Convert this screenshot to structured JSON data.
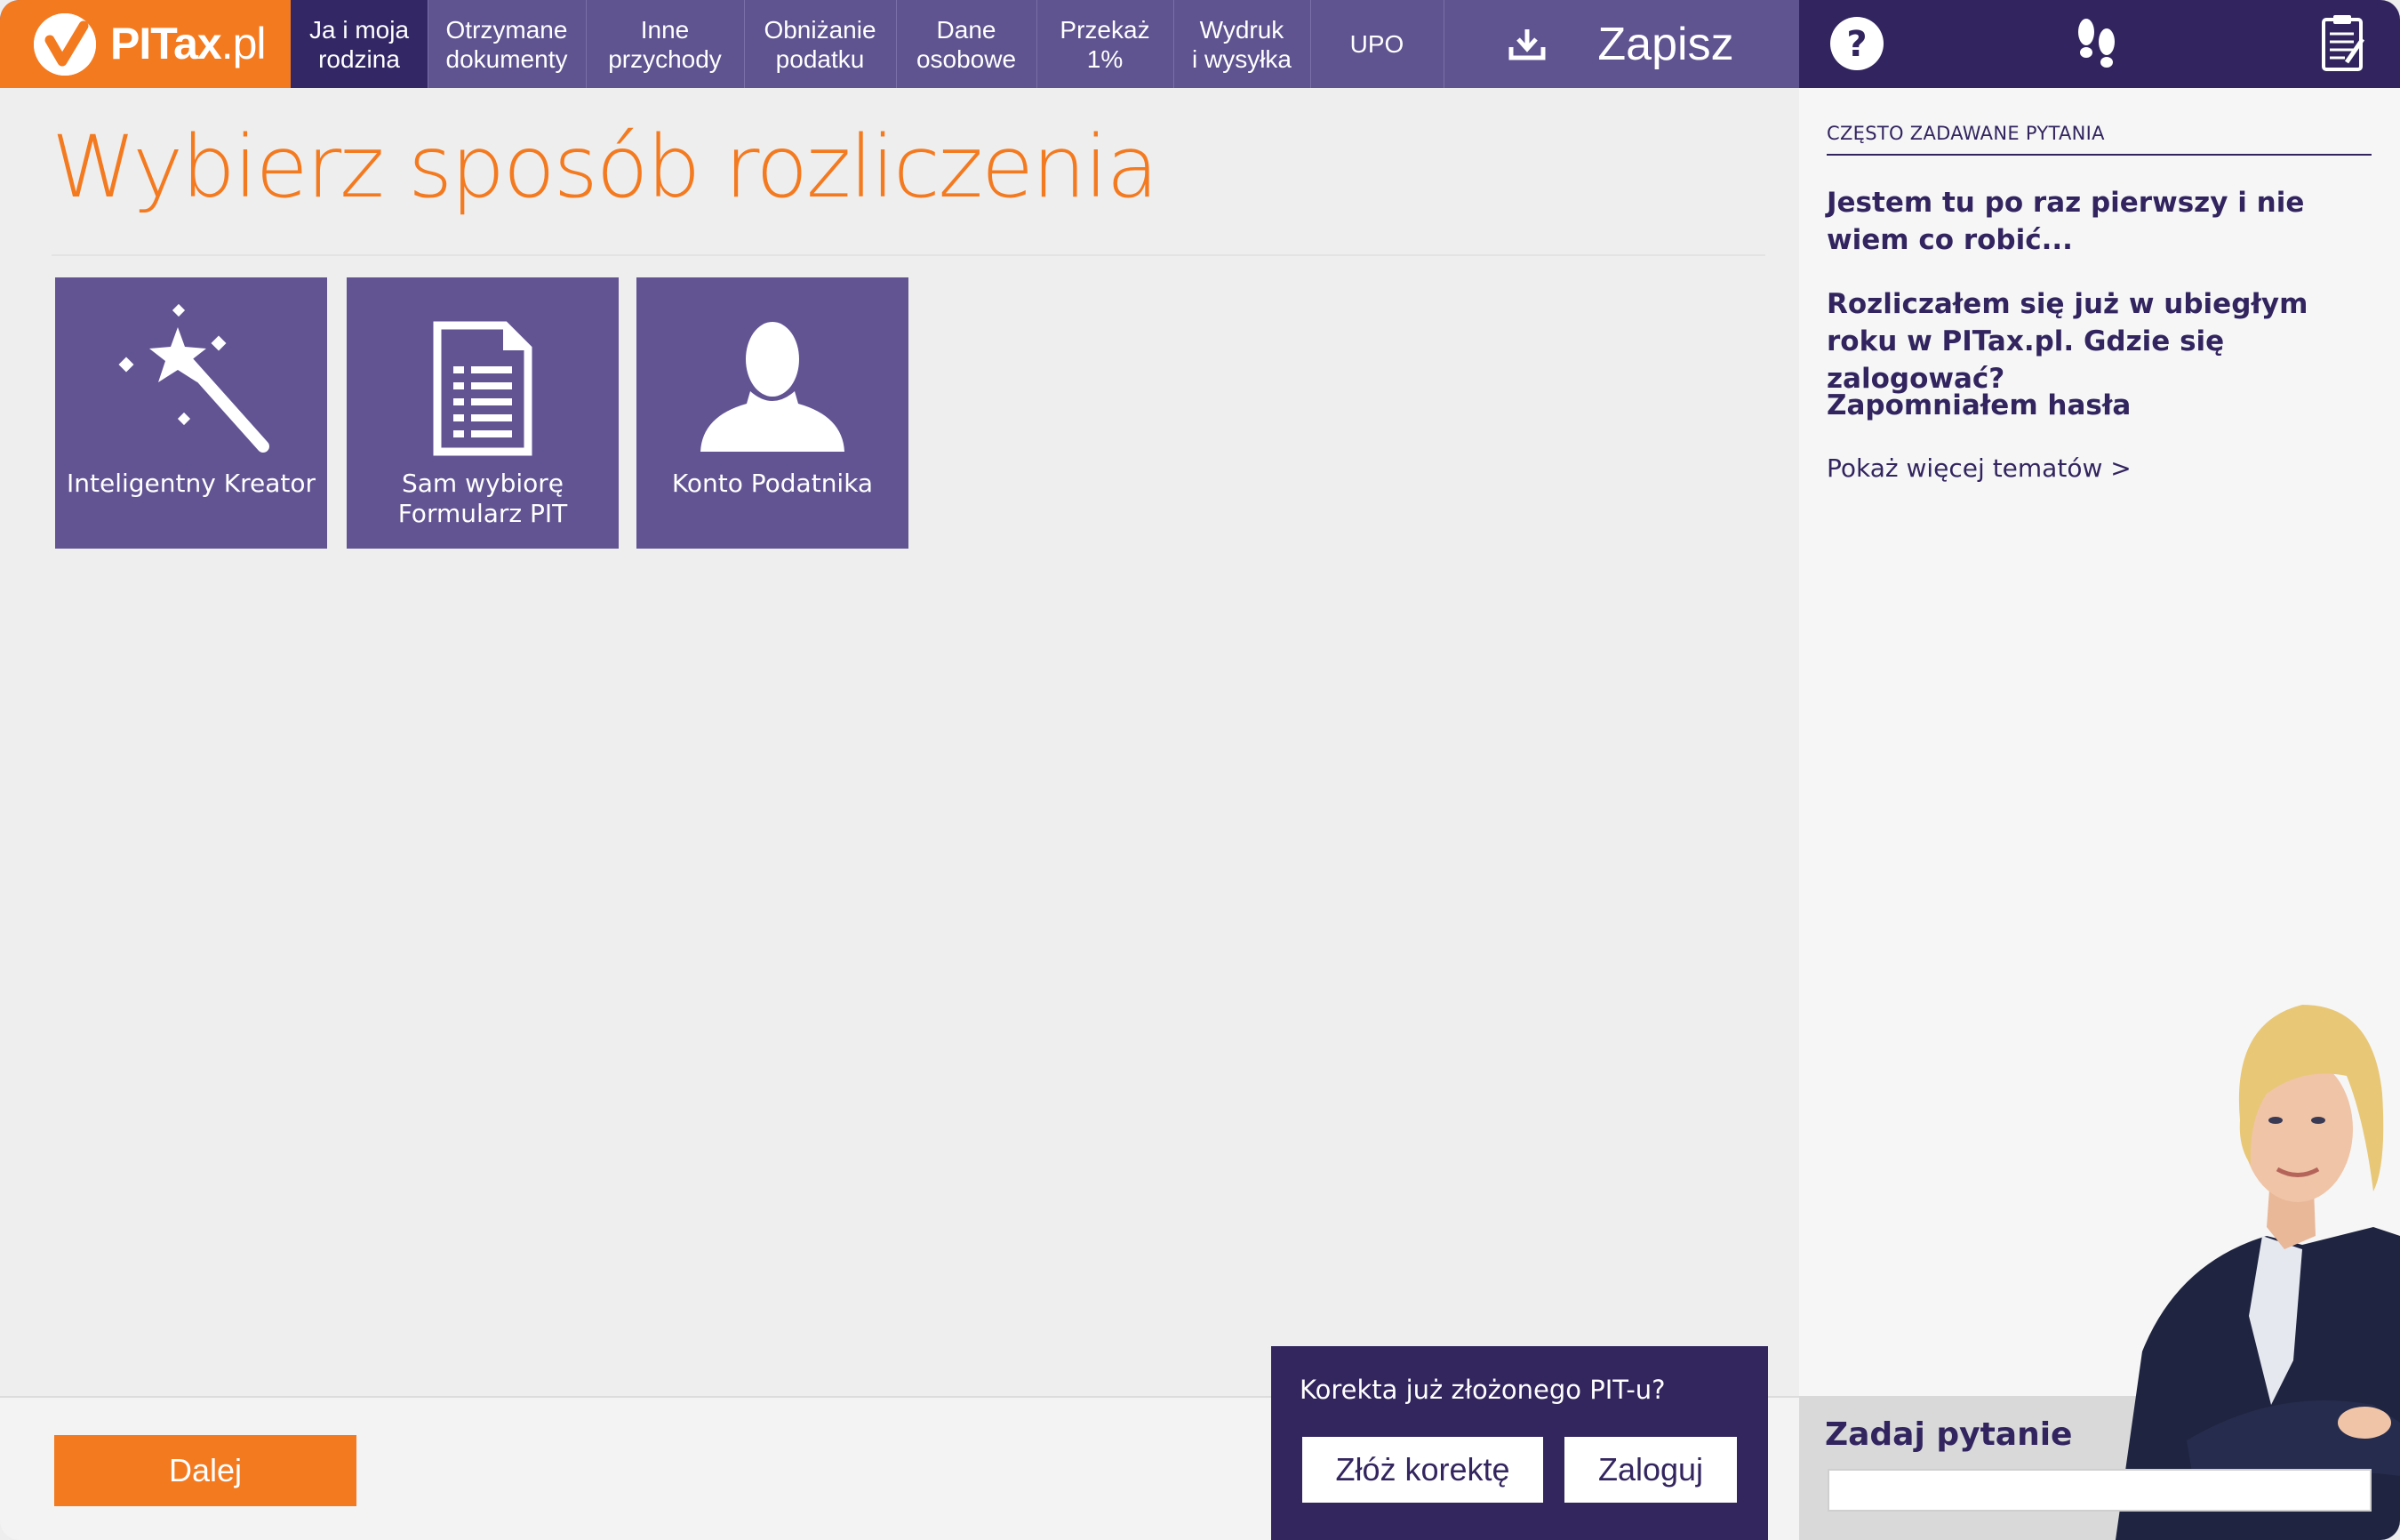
{
  "logo": {
    "text_bold": "PITax",
    "text_light": ".pl"
  },
  "nav": {
    "tabs": [
      {
        "label": "Ja i moja\nrodzina",
        "active": true
      },
      {
        "label": "Otrzymane\ndokumenty",
        "active": false
      },
      {
        "label": "Inne\nprzychody",
        "active": false
      },
      {
        "label": "Obniżanie\npodatku",
        "active": false
      },
      {
        "label": "Dane\nosobowe",
        "active": false
      },
      {
        "label": "Przekaż\n1%",
        "active": false
      },
      {
        "label": "Wydruk\ni wysyłka",
        "active": false
      },
      {
        "label": "UPO",
        "active": false
      }
    ],
    "save_label": "Zapisz",
    "save_icon": "download-icon"
  },
  "right_icons": [
    "help-icon",
    "footsteps-icon",
    "clipboard-icon"
  ],
  "main": {
    "title": "Wybierz sposób rozliczenia",
    "tiles": [
      {
        "label": "Inteligentny Kreator",
        "icon": "magic-wand-icon"
      },
      {
        "label": "Sam wybiorę\nFormularz PIT",
        "icon": "document-list-icon"
      },
      {
        "label": "Konto Podatnika",
        "icon": "user-silhouette-icon"
      }
    ],
    "next_label": "Dalej"
  },
  "correction": {
    "question": "Korekta już złożonego PIT-u?",
    "submit_label": "Złóż korektę",
    "login_label": "Zaloguj"
  },
  "faq": {
    "heading": "CZĘSTO ZADAWANE PYTANIA",
    "questions": [
      "Jestem tu po raz pierwszy i nie wiem co robić...",
      "Rozliczałem się już w ubiegłym roku w PITax.pl. Gdzie się zalogować?",
      "Zapomniałem hasła"
    ],
    "more_label": "Pokaż więcej tematów >"
  },
  "ask": {
    "label": "Zadaj pytanie",
    "placeholder": ""
  },
  "colors": {
    "accent": "#f47a20",
    "nav": "#5f5390",
    "nav_dark": "#32255f",
    "tile": "#625493"
  }
}
